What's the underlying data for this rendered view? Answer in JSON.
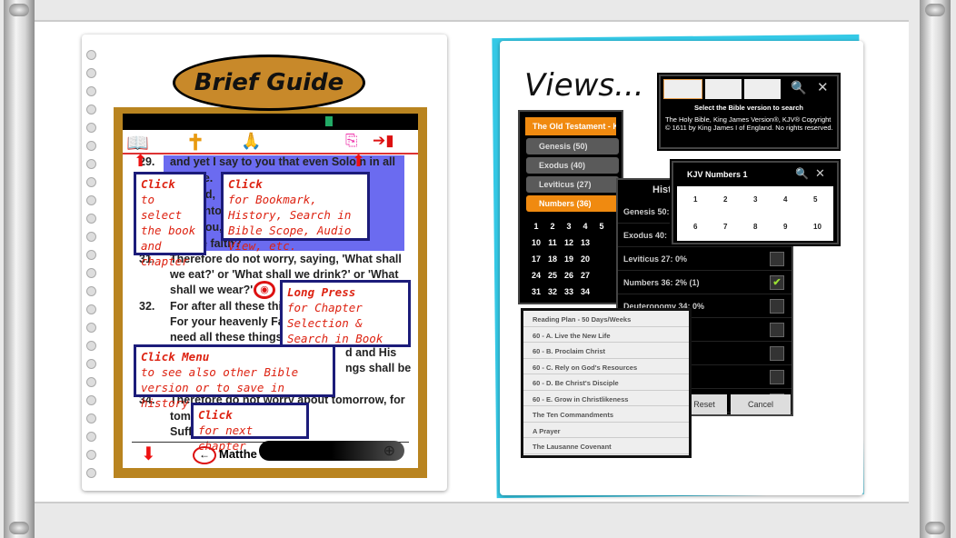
{
  "guide": {
    "title": "Brief Guide",
    "verses": [
      {
        "n": "29.",
        "lines": [
          "and yet I say to you that even Solo     n in all",
          "ory                                    ese.",
          "Go                                    field,",
          "tod                                   n into",
          "en,                                   e you,",
          "of little faith?"
        ]
      },
      {
        "n": "31.",
        "lines": [
          "Therefore do not worry, saying, 'What shall",
          "we eat?' or 'What shall we drink?' or 'What",
          "shall we wear?'"
        ]
      },
      {
        "n": "32.",
        "lines": [
          "For after all these thi",
          "For your heavenly Fa",
          "need all these things"
        ]
      },
      {
        "n": "33.",
        "lines": [
          "d and His",
          "ngs shall be"
        ]
      },
      {
        "n": "34.",
        "lines": [
          "Therefore do not worry about tomorrow, for",
          "tom                          its own things.",
          "Suff                          own trouble."
        ]
      }
    ],
    "callouts": [
      {
        "head": "Click",
        "body": "to select the book and chapter"
      },
      {
        "head": "Click",
        "body": "for Bookmark, History, Search in Bible Scope, Audio View, etc."
      },
      {
        "head": "Long Press",
        "body": "for Chapter Selection & Search in Book Scope"
      },
      {
        "head": "Click Menu",
        "body": "to see also other Bible version or to save in history"
      },
      {
        "head": "Click",
        "body": "for next chapter"
      }
    ],
    "bottom_book": "Matthe",
    "back_arrow": "←",
    "zoom_icon": "⊕"
  },
  "views": {
    "title": "Views...",
    "testament_header": "The Old Testament  -  KJV",
    "books": [
      "Genesis (50)",
      "Exodus (40)",
      "Leviticus (27)",
      "Numbers (36)"
    ],
    "chapters": [
      "1",
      "2",
      "3",
      "4",
      "5",
      "10",
      "11",
      "12",
      "13",
      "17",
      "18",
      "19",
      "20",
      "24",
      "25",
      "26",
      "27",
      "31",
      "32",
      "33",
      "34"
    ],
    "search": {
      "prompt": "Select the Bible version to search",
      "copyright": "The Holy Bible, King James Version®, KJV® Copyright © 1611 by King James I of England. No rights reserved."
    },
    "numbers_dialog": {
      "title": "KJV Numbers 1",
      "chapters": [
        "1",
        "2",
        "3",
        "4",
        "5",
        "6",
        "7",
        "8",
        "9",
        "10"
      ]
    },
    "history": {
      "title": "Hist",
      "rows": [
        {
          "label": "Genesis 50: ",
          "checked": false
        },
        {
          "label": "Exodus 40: 1",
          "checked": false
        },
        {
          "label": "Leviticus 27: 0%",
          "checked": false
        },
        {
          "label": "Numbers 36: 2% (1)",
          "checked": true
        },
        {
          "label": "Deuteronomy 34: 0%",
          "checked": false
        }
      ],
      "reset": "Reset",
      "cancel": "Cancel"
    },
    "plans": [
      "Reading Plan - 50 Days/Weeks",
      "60 - A. Live the New Life",
      "60 - B. Proclaim Christ",
      "60 - C. Rely on God's Resources",
      "60 - D. Be Christ's Disciple",
      "60 - E. Grow in Christlikeness",
      "The Ten Commandments",
      "A Prayer",
      "The Lausanne Covenant"
    ]
  },
  "colors": {
    "accent_orange": "#f08a10",
    "gold": "#b98420",
    "callout_red": "#dd1111",
    "callout_border": "#1c1c7a",
    "highlight": "#6b6bf0",
    "cyan": "#35c9e6"
  }
}
